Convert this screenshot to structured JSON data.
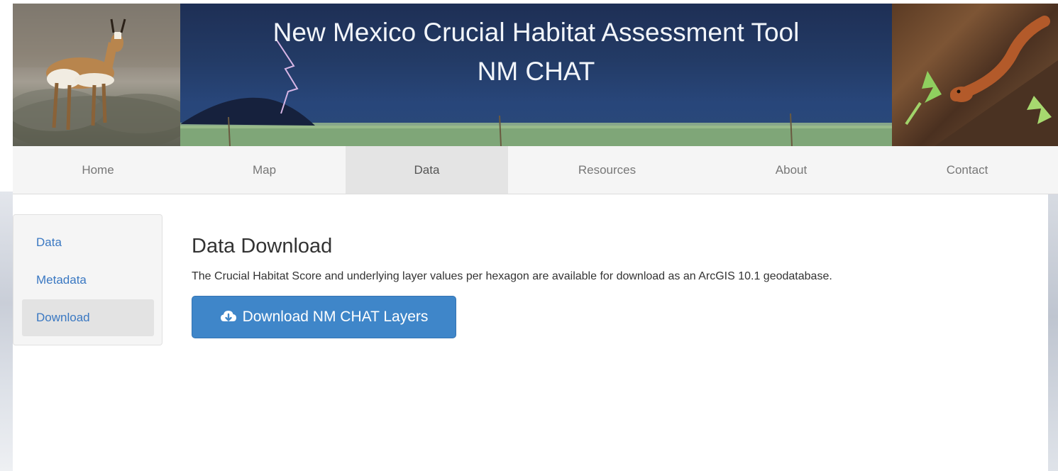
{
  "banner": {
    "title_line1": "New Mexico Crucial Habitat Assessment Tool",
    "title_line2": "NM CHAT"
  },
  "nav": {
    "items": [
      {
        "label": "Home",
        "active": false
      },
      {
        "label": "Map",
        "active": false
      },
      {
        "label": "Data",
        "active": true
      },
      {
        "label": "Resources",
        "active": false
      },
      {
        "label": "About",
        "active": false
      },
      {
        "label": "Contact",
        "active": false
      }
    ]
  },
  "sidebar": {
    "items": [
      {
        "label": "Data",
        "active": false
      },
      {
        "label": "Metadata",
        "active": false
      },
      {
        "label": "Download",
        "active": true
      }
    ]
  },
  "main": {
    "title": "Data Download",
    "description": "The Crucial Habitat Score and underlying layer values per hexagon are available for download as an ArcGIS 10.1 geodatabase.",
    "download_button": {
      "label": "Download NM CHAT Layers",
      "icon": "cloud-download-icon"
    }
  },
  "colors": {
    "link": "#3a78c2",
    "button": "#3f86c9",
    "nav_active": "#e4e4e4"
  }
}
